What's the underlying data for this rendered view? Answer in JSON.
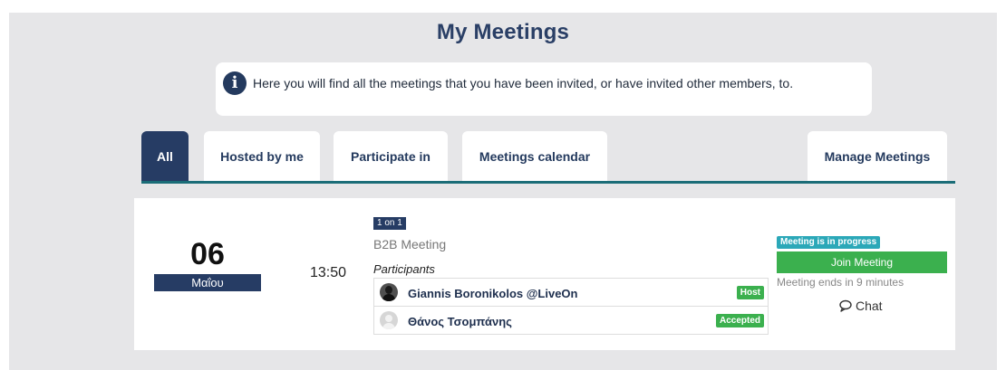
{
  "page": {
    "title": "My Meetings"
  },
  "info": {
    "text": "Here you will find all the meetings that you have been invited, or have invited other members, to."
  },
  "tabs": [
    {
      "label": "All",
      "active": true
    },
    {
      "label": "Hosted by me"
    },
    {
      "label": "Participate in"
    },
    {
      "label": "Meetings calendar"
    },
    {
      "label": "Manage Meetings"
    }
  ],
  "meeting": {
    "day": "06",
    "month": "Μαΐου",
    "time": "13:50",
    "type_badge": "1 on 1",
    "name": "B2B Meeting",
    "participants_label": "Participants",
    "participants": [
      {
        "name": "Giannis Boronikolos @LiveOn",
        "role": "Host",
        "avatar": "photo"
      },
      {
        "name": "Θάνος Τσομπάνης",
        "role": "Accepted",
        "avatar": "placeholder"
      }
    ],
    "status": "Meeting is in progress",
    "join_label": "Join Meeting",
    "ends_text": "Meeting ends in 9 minutes",
    "chat_label": "Chat"
  },
  "colors": {
    "navy": "#263c64",
    "teal": "#1b6d78",
    "green": "#3bb04e",
    "cyan_badge": "#2ba8b8",
    "background": "#e6e6e8"
  }
}
